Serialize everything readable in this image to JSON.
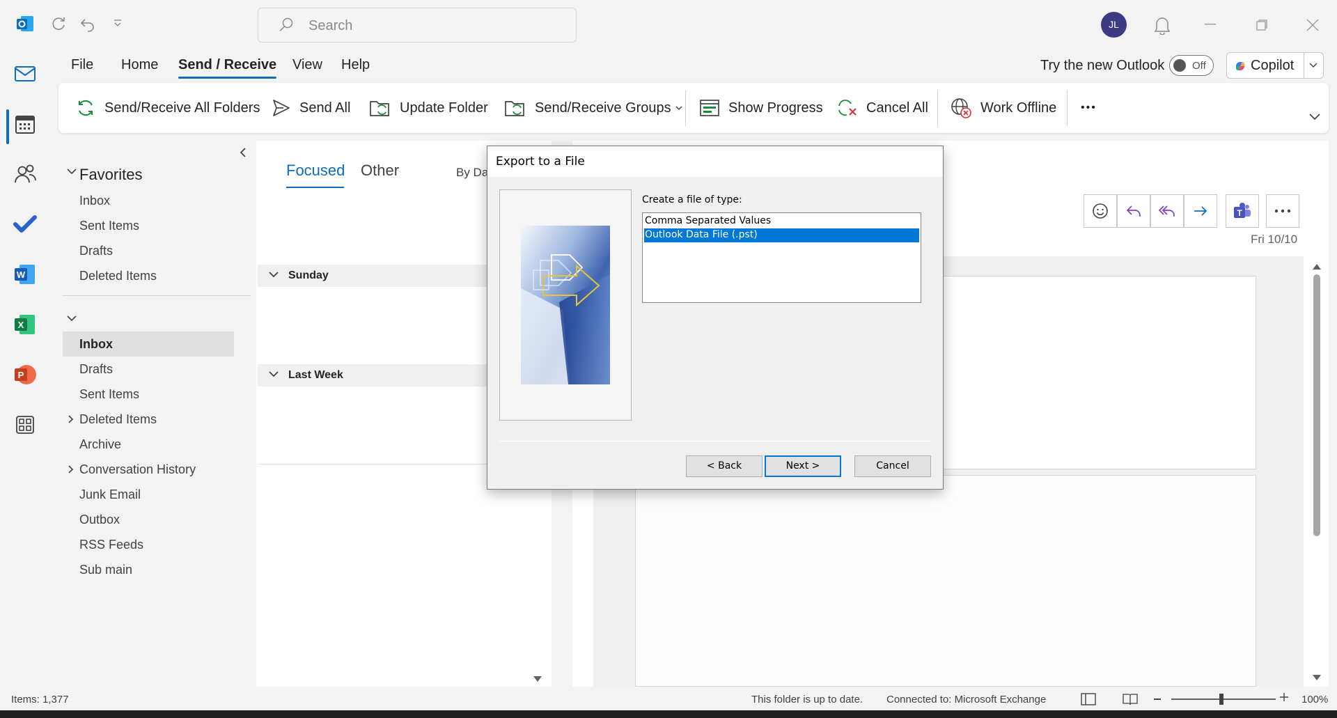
{
  "titlebar": {
    "search_placeholder": "Search",
    "avatar_initials": "JL"
  },
  "menu": {
    "tabs": [
      "File",
      "Home",
      "Send / Receive",
      "View",
      "Help"
    ],
    "active_tab": "Send / Receive",
    "try_new_outlook": "Try the new Outlook",
    "toggle_state": "Off",
    "copilot_label": "Copilot"
  },
  "ribbon": {
    "send_receive_all": "Send/Receive All Folders",
    "send_all": "Send All",
    "update_folder": "Update Folder",
    "send_receive_groups": "Send/Receive Groups",
    "show_progress": "Show Progress",
    "cancel_all": "Cancel All",
    "work_offline": "Work Offline",
    "more": "•••"
  },
  "folders": {
    "favorites_header": "Favorites",
    "favorites": [
      "Inbox",
      "Sent Items",
      "Drafts",
      "Deleted Items"
    ],
    "account_header": "",
    "account_folders": [
      "Inbox",
      "Drafts",
      "Sent Items",
      "Deleted Items",
      "Archive",
      "Conversation History",
      "Junk Email",
      "Outbox",
      "RSS Feeds",
      "Sub main"
    ],
    "selected": "Inbox"
  },
  "message_list": {
    "tab_focused": "Focused",
    "tab_other": "Other",
    "sort_label": "By Da",
    "group_sunday": "Sunday",
    "group_last_week": "Last Week"
  },
  "reading_pane": {
    "date": "Fri 10/10"
  },
  "dialog": {
    "title": "Export to a File",
    "label": "Create a file of type:",
    "options": [
      "Comma Separated Values",
      "Outlook Data File (.pst)"
    ],
    "selected_option": "Outlook Data File (.pst)",
    "back_button": "< Back",
    "next_button": "Next >",
    "cancel_button": "Cancel"
  },
  "statusbar": {
    "items": "Items: 1,377",
    "folder_status": "This folder is up to date.",
    "connection": "Connected to: Microsoft Exchange",
    "zoom": "100%"
  },
  "colors": {
    "accent": "#0f6cbd",
    "dialog_selection": "#0078d7",
    "avatar_bg": "#3b3a83"
  }
}
